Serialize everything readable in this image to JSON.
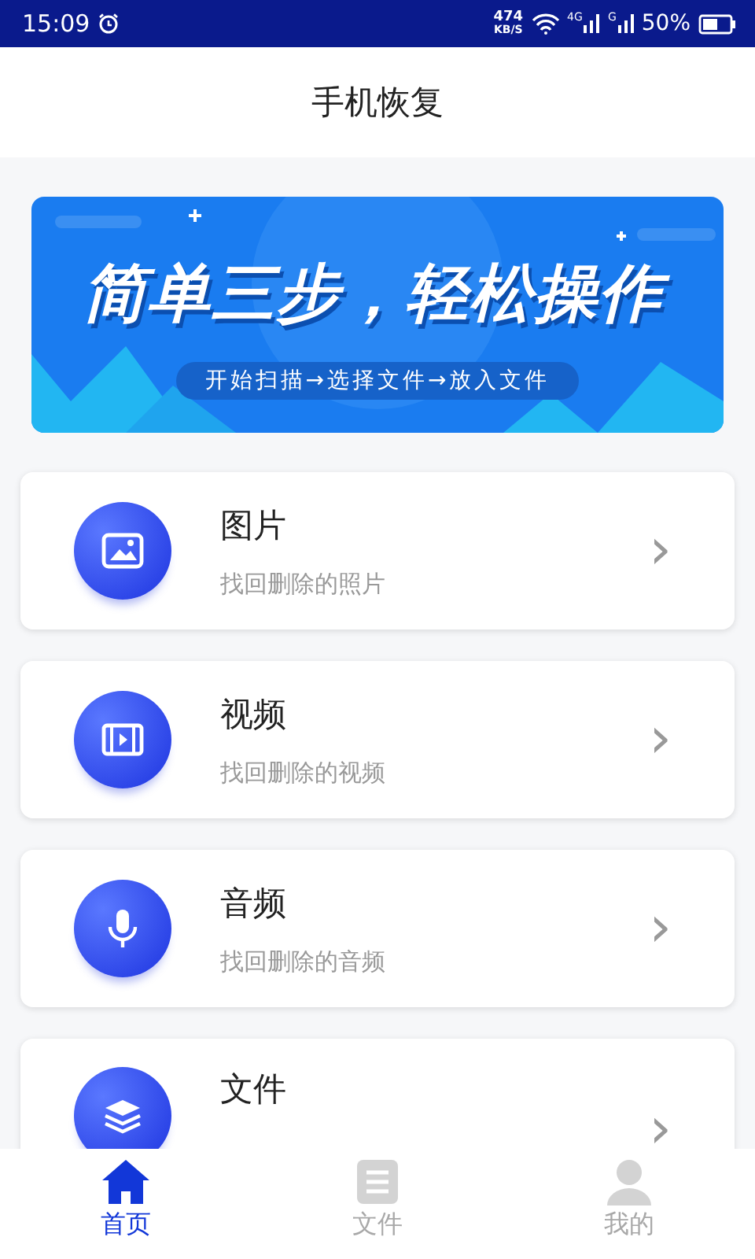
{
  "status_bar": {
    "time": "15:09",
    "speed_value": "474",
    "speed_unit": "KB/S",
    "net_1": "4G",
    "net_2": "G",
    "battery": "50%"
  },
  "header": {
    "title": "手机恢复"
  },
  "banner": {
    "headline": "简单三步，轻松操作",
    "steps": "开始扫描→选择文件→放入文件"
  },
  "cards": [
    {
      "title": "图片",
      "subtitle": "找回删除的照片",
      "chevron": "›"
    },
    {
      "title": "视频",
      "subtitle": "找回删除的视频",
      "chevron": "›"
    },
    {
      "title": "音频",
      "subtitle": "找回删除的音频",
      "chevron": "›"
    },
    {
      "title": "文件",
      "chevron": "›"
    }
  ],
  "tabs": [
    {
      "label": "首页",
      "selected": true
    },
    {
      "label": "文件",
      "selected": false
    },
    {
      "label": "我的",
      "selected": false
    }
  ]
}
